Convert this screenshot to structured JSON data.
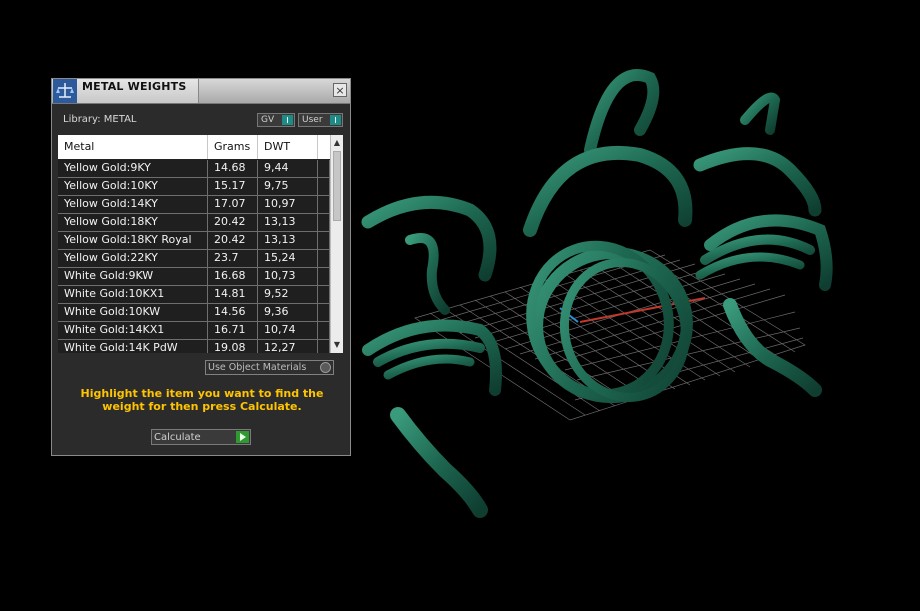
{
  "panel": {
    "title": "METAL WEIGHTS",
    "close_label": "×",
    "library_label": "Library:  METAL",
    "toggle_gv": "GV",
    "toggle_user": "User",
    "columns": [
      "Metal",
      "Grams",
      "DWT"
    ],
    "rows": [
      [
        "Yellow Gold:9KY",
        "14.68",
        "9,44"
      ],
      [
        "Yellow Gold:10KY",
        "15.17",
        "9,75"
      ],
      [
        "Yellow Gold:14KY",
        "17.07",
        "10,97"
      ],
      [
        "Yellow Gold:18KY",
        "20.42",
        "13,13"
      ],
      [
        "Yellow Gold:18KY Royal",
        "20.42",
        "13,13"
      ],
      [
        "Yellow Gold:22KY",
        "23.7",
        "15,24"
      ],
      [
        "White Gold:9KW",
        "16.68",
        "10,73"
      ],
      [
        "White Gold:10KX1",
        "14.81",
        "9,52"
      ],
      [
        "White Gold:10KW",
        "14.56",
        "9,36"
      ],
      [
        "White Gold:14KX1",
        "16.71",
        "10,74"
      ],
      [
        "White Gold:14K PdW",
        "19.08",
        "12,27"
      ]
    ],
    "use_object_materials": "Use Object Materials",
    "instructions": "Highlight the item you want to find the weight for then press Calculate.",
    "calculate_label": "Calculate"
  },
  "icons": {
    "app": "scale-icon",
    "close": "close-icon",
    "scroll_up": "chevron-up-icon",
    "scroll_down": "chevron-down-icon",
    "calculate": "play-icon"
  },
  "colors": {
    "background": "#000000",
    "model": "#1f6b55",
    "accent_toggle": "#1f8b86",
    "instruction_text": "#ffc400",
    "calculate_go": "#2f9a2f"
  }
}
